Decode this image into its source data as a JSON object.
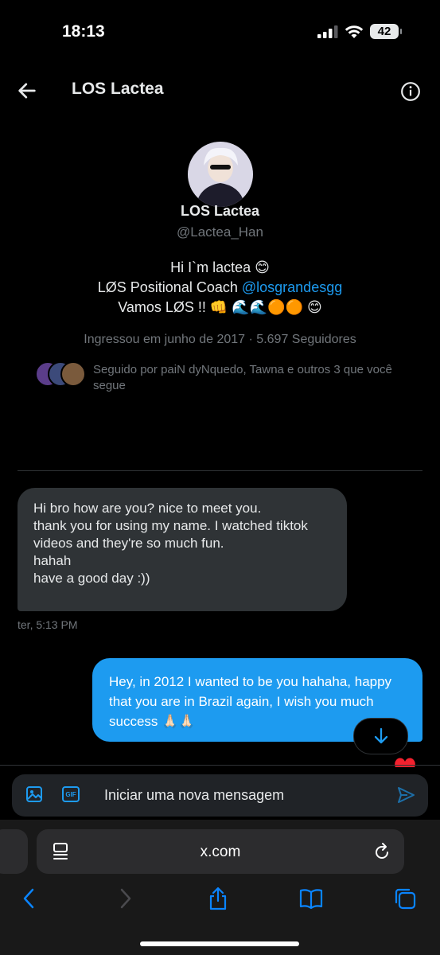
{
  "status_bar": {
    "time": "18:13",
    "battery": "42"
  },
  "header": {
    "title": "LOS Lactea"
  },
  "profile": {
    "name": "LOS Lactea",
    "handle": "@Lactea_Han",
    "bio_line1": "Hi I`m lactea 😊",
    "bio_line2_prefix": "LØS Positional Coach ",
    "bio_line2_link": "@losgrandesgg",
    "bio_line3": "Vamos LØS !! 👊 🌊🌊🟠🟠 😊",
    "joined": "Ingressou em junho de 2017 · 5.697 Seguidores",
    "followed_by": "Seguido por paiN dyNquedo, Tawna e outros 3 que você segue"
  },
  "messages": [
    {
      "direction": "incoming",
      "text": "Hi bro how are you? nice to meet you.\nthank you for using my name. I watched tiktok videos and they're so much fun.\nhahah\nhave a good day :))",
      "time": "ter, 5:13 PM"
    },
    {
      "direction": "outgoing",
      "text": "Hey, in 2012 I wanted to be you hahaha, happy that you are in Brazil again, I wish you much success 🙏🏻🙏🏻"
    }
  ],
  "composer": {
    "placeholder": "Iniciar uma nova mensagem",
    "gif_label": "GIF"
  },
  "browser": {
    "url": "x.com"
  },
  "colors": {
    "accent": "#1d9bf0",
    "bubble_incoming": "#2f3336",
    "background": "#000000"
  }
}
